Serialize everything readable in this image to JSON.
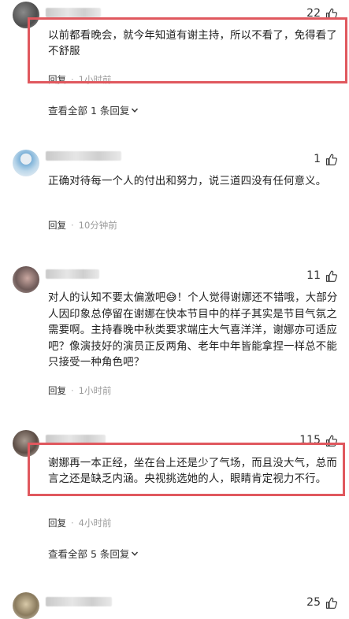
{
  "comments": [
    {
      "likes": "22",
      "text": "以前都看晚会，就今年知道有谢主持，所以不看了，免得看了不舒服",
      "reply_label": "回复",
      "separator": "·",
      "time": "1小时前",
      "view_replies": "查看全部 1 条回复"
    },
    {
      "likes": "1",
      "text": "正确对待每一个人的付出和努力，说三道四没有任何意义。",
      "reply_label": "回复",
      "separator": "·",
      "time": "10分钟前"
    },
    {
      "likes": "11",
      "text": "对人的认知不要太偏激吧😅！个人觉得谢娜还不错哦，大部分人因印象总停留在谢娜在快本节目中的样子其实是节目气氛之需要啊。主持春晚中秋类要求端庄大气喜洋洋，谢娜亦可适应吧？像演技好的演员正反两角、老年中年皆能拿捏一样总不能只接受一种角色吧？",
      "reply_label": "回复",
      "separator": "·",
      "time": "1小时前"
    },
    {
      "likes": "115",
      "text": "谢娜再一本正经，坐在台上还是少了气场，而且没大气，总而言之还是缺乏内涵。央视挑选她的人，眼睛肯定视力不行。",
      "reply_label": "回复",
      "separator": "·",
      "time": "4小时前",
      "view_replies": "查看全部 5 条回复"
    },
    {
      "likes": "25"
    }
  ],
  "colors": {
    "highlight": "#e0585e",
    "muted": "#9a9a9a"
  },
  "icons": {
    "like": "thumbs-up-icon",
    "expand": "chevron-down-icon"
  }
}
